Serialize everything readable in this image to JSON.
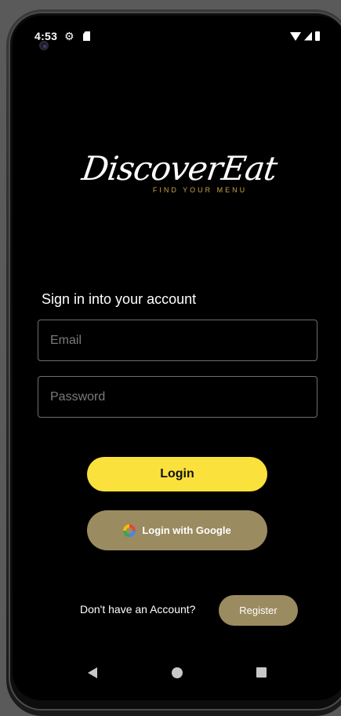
{
  "status_bar": {
    "time": "4:53",
    "icons": [
      "gear-icon",
      "sdcard-icon",
      "wifi-icon",
      "signal-icon",
      "battery-icon"
    ]
  },
  "brand": {
    "logo_text": "DiscoverEat",
    "tagline": "FIND YOUR MENU",
    "tagline_color": "#c9a24a"
  },
  "login_form": {
    "heading": "Sign in into your account",
    "email_placeholder": "Email",
    "password_placeholder": "Password",
    "login_label": "Login",
    "google_label": "Login with Google"
  },
  "register": {
    "prompt": "Don't have an Account?",
    "button_label": "Register"
  },
  "colors": {
    "login_button": "#fbe13b",
    "secondary_button": "#9b8b60",
    "background": "#000000"
  },
  "nav_bar": {
    "icons": [
      "back-icon",
      "home-icon",
      "recents-icon"
    ]
  }
}
